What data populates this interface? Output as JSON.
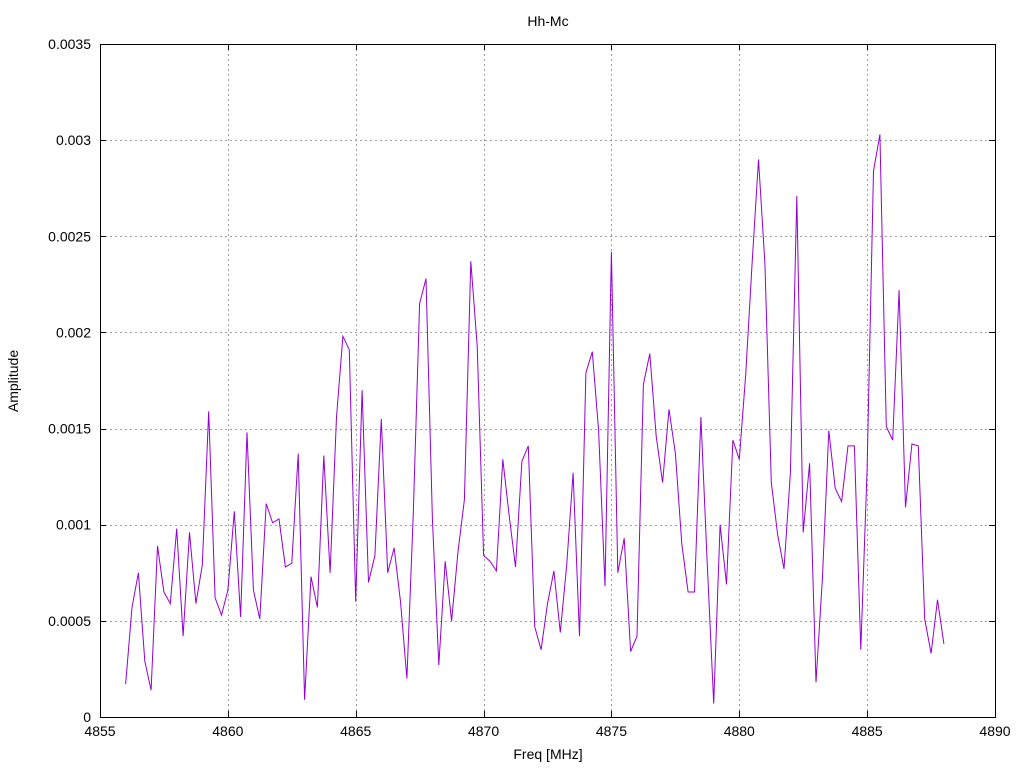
{
  "chart_data": {
    "type": "line",
    "title": "Hh-Mc",
    "xlabel": "Freq [MHz]",
    "ylabel": "Amplitude",
    "xlim": [
      4855,
      4890
    ],
    "ylim": [
      0,
      0.0035
    ],
    "grid": true,
    "x_ticks": [
      "4855",
      "4860",
      "4865",
      "4870",
      "4875",
      "4880",
      "4885",
      "4890"
    ],
    "x_tick_values": [
      4855,
      4860,
      4865,
      4870,
      4875,
      4880,
      4885,
      4890
    ],
    "y_ticks": [
      "0",
      "0.0005",
      "0.001",
      "0.0015",
      "0.002",
      "0.0025",
      "0.003",
      "0.0035"
    ],
    "y_tick_values": [
      0,
      0.0005,
      0.001,
      0.0015,
      0.002,
      0.0025,
      0.003,
      0.0035
    ],
    "series": [
      {
        "color": "#9400d3",
        "x": [
          4856.0,
          4856.25,
          4856.5,
          4856.75,
          4857.0,
          4857.25,
          4857.5,
          4857.75,
          4858.0,
          4858.25,
          4858.5,
          4858.75,
          4859.0,
          4859.25,
          4859.5,
          4859.75,
          4860.0,
          4860.25,
          4860.5,
          4860.75,
          4861.0,
          4861.25,
          4861.5,
          4861.75,
          4862.0,
          4862.25,
          4862.5,
          4862.75,
          4863.0,
          4863.25,
          4863.5,
          4863.75,
          4864.0,
          4864.25,
          4864.5,
          4864.75,
          4865.0,
          4865.25,
          4865.5,
          4865.75,
          4866.0,
          4866.25,
          4866.5,
          4866.75,
          4867.0,
          4867.25,
          4867.5,
          4867.75,
          4868.0,
          4868.25,
          4868.5,
          4868.75,
          4869.0,
          4869.25,
          4869.5,
          4869.75,
          4870.0,
          4870.25,
          4870.5,
          4870.75,
          4871.0,
          4871.25,
          4871.5,
          4871.75,
          4872.0,
          4872.25,
          4872.5,
          4872.75,
          4873.0,
          4873.25,
          4873.5,
          4873.75,
          4874.0,
          4874.25,
          4874.5,
          4874.75,
          4875.0,
          4875.25,
          4875.5,
          4875.75,
          4876.0,
          4876.25,
          4876.5,
          4876.75,
          4877.0,
          4877.25,
          4877.5,
          4877.75,
          4878.0,
          4878.25,
          4878.5,
          4878.75,
          4879.0,
          4879.25,
          4879.5,
          4879.75,
          4880.0,
          4880.25,
          4880.5,
          4880.75,
          4881.0,
          4881.25,
          4881.5,
          4881.75,
          4882.0,
          4882.25,
          4882.5,
          4882.75,
          4883.0,
          4883.25,
          4883.5,
          4883.75,
          4884.0,
          4884.25,
          4884.5,
          4884.75,
          4885.0,
          4885.25,
          4885.5,
          4885.75,
          4886.0,
          4886.25,
          4886.5,
          4886.75,
          4887.0,
          4887.25,
          4887.5,
          4887.75,
          4888.0
        ],
        "y": [
          0.00017,
          0.00057,
          0.00075,
          0.00029,
          0.00014,
          0.00089,
          0.00065,
          0.00059,
          0.00098,
          0.00042,
          0.00096,
          0.00059,
          0.00079,
          0.00159,
          0.00062,
          0.00053,
          0.00066,
          0.00107,
          0.00052,
          0.00148,
          0.00066,
          0.00051,
          0.00111,
          0.00101,
          0.00103,
          0.00078,
          0.0008,
          0.00137,
          9e-05,
          0.00073,
          0.00057,
          0.00136,
          0.00075,
          0.00156,
          0.00198,
          0.00191,
          0.0006,
          0.0017,
          0.0007,
          0.00084,
          0.00155,
          0.00075,
          0.00088,
          0.0006,
          0.0002,
          0.00106,
          0.00215,
          0.00228,
          0.00103,
          0.00027,
          0.00081,
          0.0005,
          0.00086,
          0.00113,
          0.00237,
          0.00193,
          0.00084,
          0.00081,
          0.00076,
          0.00134,
          0.00105,
          0.00078,
          0.00133,
          0.00141,
          0.00047,
          0.00035,
          0.00059,
          0.00076,
          0.00044,
          0.00079,
          0.00127,
          0.00042,
          0.00179,
          0.0019,
          0.00149,
          0.00068,
          0.00242,
          0.00075,
          0.00093,
          0.00034,
          0.00042,
          0.00173,
          0.00189,
          0.00146,
          0.00122,
          0.0016,
          0.00137,
          0.0009,
          0.00065,
          0.00065,
          0.00156,
          0.00079,
          7e-05,
          0.001,
          0.00069,
          0.00144,
          0.00134,
          0.00178,
          0.00236,
          0.0029,
          0.00236,
          0.00122,
          0.00095,
          0.00077,
          0.00127,
          0.00271,
          0.00096,
          0.00132,
          0.00018,
          0.00072,
          0.00149,
          0.00119,
          0.00112,
          0.00141,
          0.00141,
          0.00035,
          0.00129,
          0.00284,
          0.00303,
          0.00151,
          0.00144,
          0.00222,
          0.00109,
          0.00142,
          0.00141,
          0.00051,
          0.00033,
          0.00061,
          0.00038
        ]
      }
    ]
  }
}
